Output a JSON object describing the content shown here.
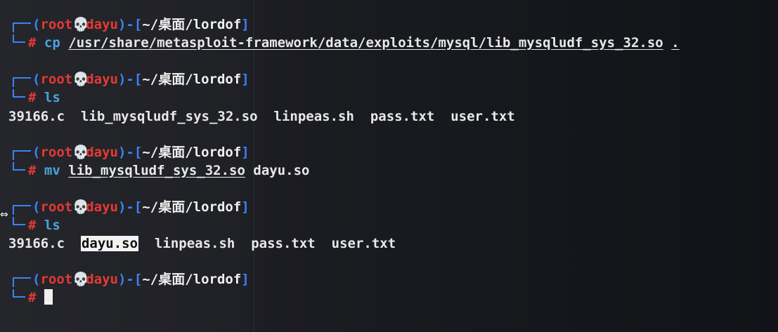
{
  "prompt": {
    "user": "root",
    "skull_icon": "skull-icon",
    "host": "dayu",
    "cwd": "~/桌面/lordof",
    "symbol": "#"
  },
  "entries": [
    {
      "command": "cp",
      "args": [
        "/usr/share/metasploit-framework/data/exploits/mysql/lib_mysqludf_sys_32.so",
        "."
      ]
    },
    {
      "command": "ls",
      "output": [
        "39166.c",
        "lib_mysqludf_sys_32.so",
        "linpeas.sh",
        "pass.txt",
        "user.txt"
      ]
    },
    {
      "command": "mv",
      "args": [
        "lib_mysqludf_sys_32.so",
        "dayu.so"
      ]
    },
    {
      "command": "ls",
      "output": [
        "39166.c",
        "dayu.so",
        "linpeas.sh",
        "pass.txt",
        "user.txt"
      ],
      "highlighted": "dayu.so"
    }
  ],
  "colors": {
    "prompt_frame": "#3b82f6",
    "user_host": "#e53935",
    "path": "#f0f0f0",
    "command": "#4aa3df",
    "background": "#1b1c21"
  }
}
